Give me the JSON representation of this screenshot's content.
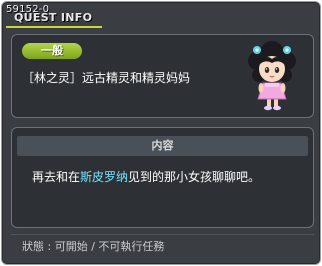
{
  "header": {
    "quest_id": "59152-0",
    "title": "QUEST INFO"
  },
  "quest": {
    "category_tag": "一般",
    "name": "［林之灵］远古精灵和精灵妈妈",
    "npc_icon": "npc-girl-portrait-icon"
  },
  "description": {
    "header": "内容",
    "text_before": "再去和在",
    "highlight": "斯皮罗纳",
    "text_after": "见到的那小女孩聊聊吧。",
    "highlight_color": "#74e3ff"
  },
  "status": {
    "text": "狀態 : 可開始 / 不可執行任務"
  },
  "colors": {
    "tag_green": "#9cc236",
    "window_bg": "#3a3d42",
    "accent_underline": "#c7d63a"
  }
}
